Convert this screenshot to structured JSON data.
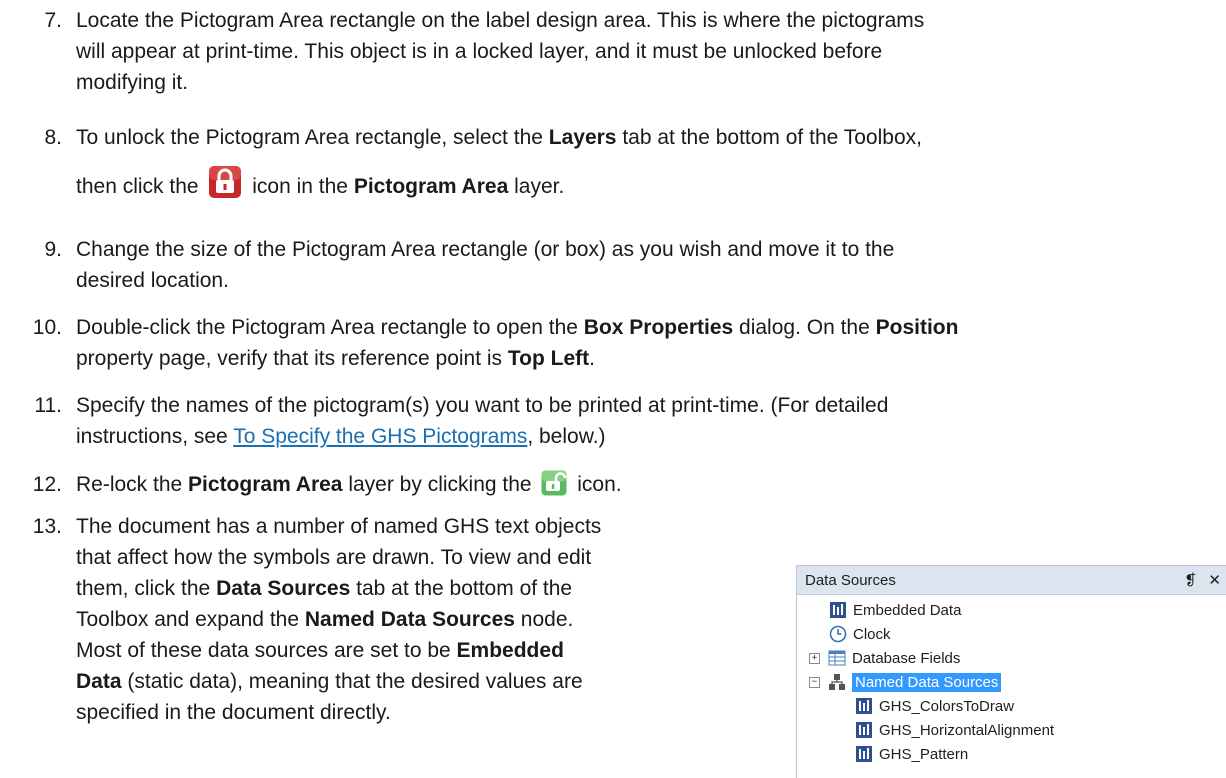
{
  "steps": [
    {
      "number": "7.",
      "lines": [
        "Locate the Pictogram Area rectangle on the label design area. This is where the pictograms",
        "will appear at print-time. This object is in a locked layer, and it must be unlocked before",
        "modifying it."
      ]
    },
    {
      "number": "8.",
      "l1_a": "To unlock the Pictogram Area rectangle, select the ",
      "l1_b": "Layers",
      "l1_c": " tab at the bottom of the Toolbox,",
      "l2_a": "then click the ",
      "l2_b": " icon in the ",
      "l2_c": "Pictogram Area",
      "l2_d": " layer."
    },
    {
      "number": "9.",
      "lines": [
        "Change the size of the Pictogram Area rectangle (or box) as you wish and move it to the",
        "desired location."
      ]
    },
    {
      "number": "10.",
      "l1_a": "Double-click the Pictogram Area rectangle to open the ",
      "l1_b": "Box Properties",
      "l1_c": " dialog. On the ",
      "l1_d": "Position",
      "l2_a": "property page, verify that its reference point is ",
      "l2_b": "Top Left",
      "l2_c": "."
    },
    {
      "number": "11.",
      "l1": "Specify the names of the pictogram(s) you want to be printed at print-time. (For detailed",
      "l2_a": "instructions, see ",
      "l2_link": "To Specify the GHS Pictograms",
      "l2_c": ", below.)"
    },
    {
      "number": "12.",
      "a": "Re-lock the ",
      "b": "Pictogram Area",
      "c": " layer by clicking the ",
      "d": " icon."
    },
    {
      "number": "13.",
      "l1": "The document has a number of named GHS text objects",
      "l2": "that affect how the symbols are drawn. To view and edit",
      "l3_a": "them, click the ",
      "l3_b": "Data Sources",
      "l3_c": " tab at the bottom of the",
      "l4_a": "Toolbox and expand the ",
      "l4_b": "Named Data Sources",
      "l4_c": " node.",
      "l5_a": "Most of these data sources are set to be ",
      "l5_b": "Embedded",
      "l6_a": "Data",
      "l6_b": " (static data), meaning that the desired values are",
      "l7": "specified in the document directly."
    }
  ],
  "panel": {
    "title": "Data Sources",
    "pin": "❡",
    "close": "✕",
    "items": [
      {
        "label": "Embedded Data",
        "icon": "embedded-data-icon"
      },
      {
        "label": "Clock",
        "icon": "clock-icon"
      },
      {
        "label": "Database Fields",
        "icon": "database-fields-icon",
        "expander": "+"
      },
      {
        "label": "Named Data Sources",
        "icon": "named-data-sources-icon",
        "expander": "−",
        "selected": true
      },
      {
        "label": "GHS_ColorsToDraw",
        "icon": "embedded-data-icon"
      },
      {
        "label": "GHS_HorizontalAlignment",
        "icon": "embedded-data-icon"
      },
      {
        "label": "GHS_Pattern",
        "icon": "embedded-data-icon"
      }
    ]
  },
  "colors": {
    "link": "#1a6fb3",
    "lock_locked": "#c62828",
    "lock_unlocked": "#5cb85c",
    "panel_header": "#dce4ef",
    "selection": "#3399ff"
  }
}
